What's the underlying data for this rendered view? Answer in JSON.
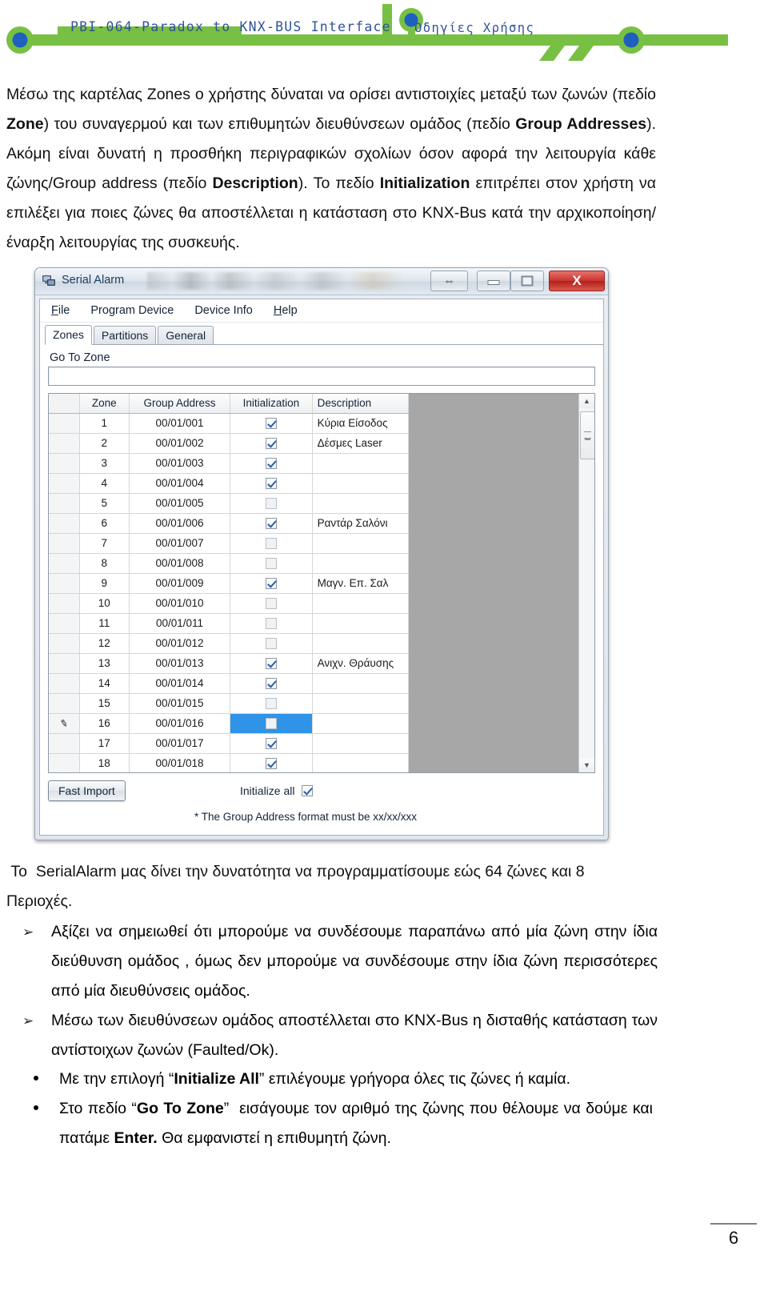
{
  "header": {
    "title_main": "PBI-064-Paradox to KNX-BUS Interface",
    "title_sub": "Οδηγίες Χρήσης",
    "green": "#77c043",
    "blue": "#1f5fbf"
  },
  "document": {
    "intro_paragraph_html": "Μέσω της καρτέλας Zones ο χρήστης δύναται να ορίσει αντιστοιχίες μεταξύ των ζωνών (πεδίο <b>Zone</b>) του συναγερμού και των επιθυμητών διευθύνσεων ομάδος (πεδίο <b>Group Addresses</b>). Ακόμη είναι δυνατή η προσθήκη περιγραφικών σχολίων όσον αφορά την λειτουργία κάθε ζώνης/Group address (πεδίο <b>Description</b>). Το πεδίο <b>Initialization</b> επιτρέπει στον χρήστη να επιλέξει για ποιες ζώνες θα αποστέλλεται η κατάσταση στο KNX-Bus κατά την αρχικοποίηση/έναρξη λειτουργίας της συσκευής.",
    "serialalarm_paragraph_html": "&nbsp;Το&nbsp; SerialAlarm μας δίνει την δυνατότητα να προγραμματίσουμε εώς 64 ζώνες και 8 Περιοχές.",
    "arrow_bullets_html": [
      "Αξίζει να σημειωθεί ότι μπορούμε να συνδέσουμε παραπάνω από μία ζώνη στην ίδια διεύθυνση ομάδος , όμως δεν μπορούμε να συνδέσουμε στην ίδια ζώνη περισσότερες από μία διευθύνσεις ομάδος.",
      "Μέσω των διευθύνσεων ομάδος αποστέλλεται στο KNX-Bus η δισταθής κατάσταση των αντίστοιχων ζωνών (Faulted/Ok)."
    ],
    "dot_bullets_html": [
      "Με την επιλογή &ldquo;<b>Initialize All</b>&rdquo; επιλέγουμε γρήγορα όλες τις ζώνες ή καμία.",
      "Στο πεδίο &ldquo;<b>Go To Zone</b>&rdquo;&nbsp; εισάγουμε τον αριθμό της ζώνης που θέλουμε να δούμε και πατάμε <b>Enter.</b> Θα εμφανιστεί η επιθυμητή ζώνη."
    ],
    "page_number": "6"
  },
  "app": {
    "window_title": "Serial Alarm",
    "titlebar_buttons": {
      "resize_label": "⇔",
      "minimize_label": "",
      "maximize_label": "",
      "close_label": "X"
    },
    "menu": [
      {
        "label": "File",
        "accel": "F"
      },
      {
        "label": "Program Device",
        "accel": ""
      },
      {
        "label": "Device Info",
        "accel": ""
      },
      {
        "label": "Help",
        "accel": "H"
      }
    ],
    "tabs": [
      {
        "label": "Zones",
        "active": true
      },
      {
        "label": "Partitions",
        "active": false
      },
      {
        "label": "General",
        "active": false
      }
    ],
    "goto_zone": {
      "label": "Go To Zone",
      "value": "",
      "placeholder": ""
    },
    "grid": {
      "columns": [
        "",
        "Zone",
        "Group Address",
        "Initialization",
        "Description"
      ],
      "rows": [
        {
          "zone": "1",
          "address": "00/01/001",
          "init": true,
          "description": "Κύρια Είσοδος",
          "selected": false,
          "edit_marker": false
        },
        {
          "zone": "2",
          "address": "00/01/002",
          "init": true,
          "description": "Δέσμες Laser",
          "selected": false,
          "edit_marker": false
        },
        {
          "zone": "3",
          "address": "00/01/003",
          "init": true,
          "description": "",
          "selected": false,
          "edit_marker": false
        },
        {
          "zone": "4",
          "address": "00/01/004",
          "init": true,
          "description": "",
          "selected": false,
          "edit_marker": false
        },
        {
          "zone": "5",
          "address": "00/01/005",
          "init": false,
          "description": "",
          "selected": false,
          "edit_marker": false
        },
        {
          "zone": "6",
          "address": "00/01/006",
          "init": true,
          "description": "Ραντάρ Σαλόνι",
          "selected": false,
          "edit_marker": false
        },
        {
          "zone": "7",
          "address": "00/01/007",
          "init": false,
          "description": "",
          "selected": false,
          "edit_marker": false
        },
        {
          "zone": "8",
          "address": "00/01/008",
          "init": false,
          "description": "",
          "selected": false,
          "edit_marker": false
        },
        {
          "zone": "9",
          "address": "00/01/009",
          "init": true,
          "description": "Μαγν. Επ. Σαλ",
          "selected": false,
          "edit_marker": false
        },
        {
          "zone": "10",
          "address": "00/01/010",
          "init": false,
          "description": "",
          "selected": false,
          "edit_marker": false
        },
        {
          "zone": "11",
          "address": "00/01/011",
          "init": false,
          "description": "",
          "selected": false,
          "edit_marker": false
        },
        {
          "zone": "12",
          "address": "00/01/012",
          "init": false,
          "description": "",
          "selected": false,
          "edit_marker": false
        },
        {
          "zone": "13",
          "address": "00/01/013",
          "init": true,
          "description": "Ανιχν. Θράυσης",
          "selected": false,
          "edit_marker": false
        },
        {
          "zone": "14",
          "address": "00/01/014",
          "init": true,
          "description": "",
          "selected": false,
          "edit_marker": false
        },
        {
          "zone": "15",
          "address": "00/01/015",
          "init": false,
          "description": "",
          "selected": false,
          "edit_marker": false
        },
        {
          "zone": "16",
          "address": "00/01/016",
          "init": false,
          "description": "",
          "selected": true,
          "edit_marker": true
        },
        {
          "zone": "17",
          "address": "00/01/017",
          "init": true,
          "description": "",
          "selected": false,
          "edit_marker": false
        },
        {
          "zone": "18",
          "address": "00/01/018",
          "init": true,
          "description": "",
          "selected": false,
          "edit_marker": false
        }
      ]
    },
    "footer": {
      "fast_import_label": "Fast Import",
      "initialize_all_label": "Initialize all",
      "initialize_all_checked": true,
      "format_note": "* The Group Address format must be xx/xx/xxx"
    },
    "colors": {
      "selection_blue": "#2f94e8",
      "close_red": "#c9332c",
      "grid_empty_gray": "#a7a7a7"
    }
  }
}
